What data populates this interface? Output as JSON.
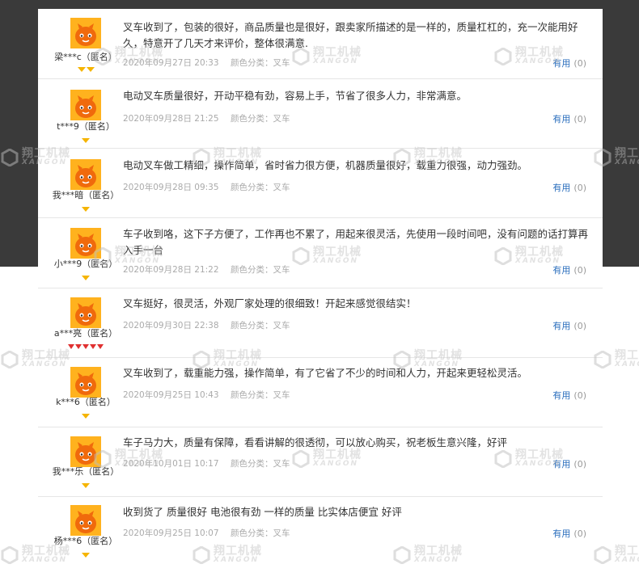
{
  "watermark": {
    "cn": "翔工机械",
    "en": "XANGON"
  },
  "reviews": [
    {
      "user": "梁***c（匿名）",
      "text": "叉车收到了，包装的很好，商品质量也是很好，跟卖家所描述的是一样的，质量杠杠的，充一次能用好久，特意开了几天才来评价，整体很满意.",
      "time": "2020年09月27日 20:33",
      "color": "颜色分类：叉车",
      "useful_label": "有用",
      "useful_count": "(0)",
      "badge_type": "gold",
      "badge_count": 2
    },
    {
      "user": "t***9（匿名）",
      "text": "电动叉车质量很好，开动平稳有劲，容易上手，节省了很多人力，非常满意。",
      "time": "2020年09月28日 21:25",
      "color": "颜色分类：叉车",
      "useful_label": "有用",
      "useful_count": "(0)",
      "badge_type": "gold",
      "badge_count": 1
    },
    {
      "user": "我***暗（匿名）",
      "text": "电动叉车做工精细，操作简单，省时省力很方便，机器质量很好，载重力很强，动力强劲。",
      "time": "2020年09月28日 09:35",
      "color": "颜色分类：叉车",
      "useful_label": "有用",
      "useful_count": "(0)",
      "badge_type": "gold",
      "badge_count": 1
    },
    {
      "user": "小***9（匿名）",
      "text": "车子收到咯，这下子方便了，工作再也不累了，用起来很灵活，先使用一段时间吧，没有问题的话打算再入手一台",
      "time": "2020年09月28日 21:22",
      "color": "颜色分类：叉车",
      "useful_label": "有用",
      "useful_count": "(0)",
      "badge_type": "gold",
      "badge_count": 1
    },
    {
      "user": "a***亮（匿名）",
      "text": "叉车挺好，很灵活，外观厂家处理的很细致！开起来感觉很结实！",
      "time": "2020年09月30日 22:38",
      "color": "颜色分类：叉车",
      "useful_label": "有用",
      "useful_count": "(0)",
      "badge_type": "red",
      "badge_count": 5
    },
    {
      "user": "k***6（匿名）",
      "text": "叉车收到了，载重能力强，操作简单，有了它省了不少的时间和人力，开起来更轻松灵活。",
      "time": "2020年09月25日 10:43",
      "color": "颜色分类：叉车",
      "useful_label": "有用",
      "useful_count": "(0)",
      "badge_type": "gold",
      "badge_count": 1
    },
    {
      "user": "我***乐（匿名）",
      "text": "车子马力大，质量有保障，看看讲解的很透彻，可以放心购买，祝老板生意兴隆，好评",
      "time": "2020年10月01日 10:17",
      "color": "颜色分类：叉车",
      "useful_label": "有用",
      "useful_count": "(0)",
      "badge_type": "gold",
      "badge_count": 1
    },
    {
      "user": "杨***6（匿名）",
      "text": "收到货了 质量很好 电池很有劲 一样的质量 比实体店便宜 好评",
      "time": "2020年09月25日 10:07",
      "color": "颜色分类：叉车",
      "useful_label": "有用",
      "useful_count": "(0)",
      "badge_type": "gold",
      "badge_count": 1
    }
  ]
}
